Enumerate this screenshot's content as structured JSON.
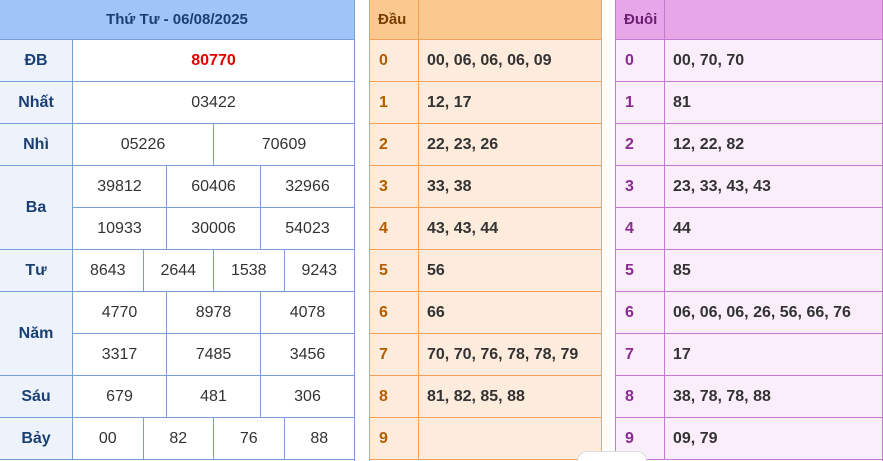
{
  "results": {
    "header": "Thứ Tư - 06/08/2025",
    "rows": [
      {
        "label": "ĐB",
        "lines": [
          [
            "80770"
          ]
        ],
        "special": true
      },
      {
        "label": "Nhất",
        "lines": [
          [
            "03422"
          ]
        ]
      },
      {
        "label": "Nhì",
        "lines": [
          [
            "05226",
            "70609"
          ]
        ]
      },
      {
        "label": "Ba",
        "lines": [
          [
            "39812",
            "60406",
            "32966"
          ],
          [
            "10933",
            "30006",
            "54023"
          ]
        ]
      },
      {
        "label": "Tư",
        "lines": [
          [
            "8643",
            "2644",
            "1538",
            "9243"
          ]
        ]
      },
      {
        "label": "Năm",
        "lines": [
          [
            "4770",
            "8978",
            "4078"
          ],
          [
            "3317",
            "7485",
            "3456"
          ]
        ]
      },
      {
        "label": "Sáu",
        "lines": [
          [
            "679",
            "481",
            "306"
          ]
        ]
      },
      {
        "label": "Bảy",
        "lines": [
          [
            "00",
            "82",
            "76",
            "88"
          ]
        ]
      }
    ]
  },
  "dau": {
    "header": "Đầu",
    "rows": [
      {
        "key": "0",
        "value": "00, 06, 06, 06, 09"
      },
      {
        "key": "1",
        "value": "12, 17"
      },
      {
        "key": "2",
        "value": "22, 23, 26"
      },
      {
        "key": "3",
        "value": "33, 38"
      },
      {
        "key": "4",
        "value": "43, 43, 44"
      },
      {
        "key": "5",
        "value": "56"
      },
      {
        "key": "6",
        "value": "66"
      },
      {
        "key": "7",
        "value": "70, 70, 76, 78, 78, 79"
      },
      {
        "key": "8",
        "value": "81, 82, 85, 88"
      },
      {
        "key": "9",
        "value": ""
      }
    ]
  },
  "duoi": {
    "header": "Đuôi",
    "rows": [
      {
        "key": "0",
        "value": "00, 70, 70"
      },
      {
        "key": "1",
        "value": "81"
      },
      {
        "key": "2",
        "value": "12, 22, 82"
      },
      {
        "key": "3",
        "value": "23, 33, 43, 43"
      },
      {
        "key": "4",
        "value": "44"
      },
      {
        "key": "5",
        "value": "85"
      },
      {
        "key": "6",
        "value": "06, 06, 06, 26, 56, 66, 76"
      },
      {
        "key": "7",
        "value": "17"
      },
      {
        "key": "8",
        "value": "38, 78, 78, 88"
      },
      {
        "key": "9",
        "value": "09, 79"
      }
    ]
  },
  "colors": {
    "special_prize": "#e00000",
    "results_header": "#9fc4f7",
    "dau_header": "#fbc98f",
    "duoi_header": "#e6a6e8"
  }
}
